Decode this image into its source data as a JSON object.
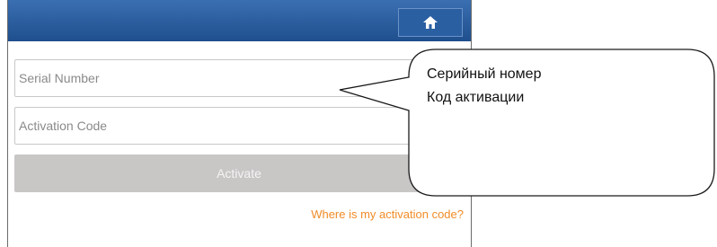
{
  "header": {
    "home_icon": "home-icon"
  },
  "form": {
    "serial_placeholder": "Serial Number",
    "serial_value": "",
    "activation_placeholder": "Activation Code",
    "activation_value": "",
    "activate_label": "Activate",
    "help_link": "Where is my activation code?"
  },
  "callout": {
    "line1": "Серийный номер",
    "line2": "Код активации"
  },
  "colors": {
    "header_bar": "#2a5fa2",
    "activate_disabled": "#c9c6c6",
    "link": "#f08c28"
  }
}
